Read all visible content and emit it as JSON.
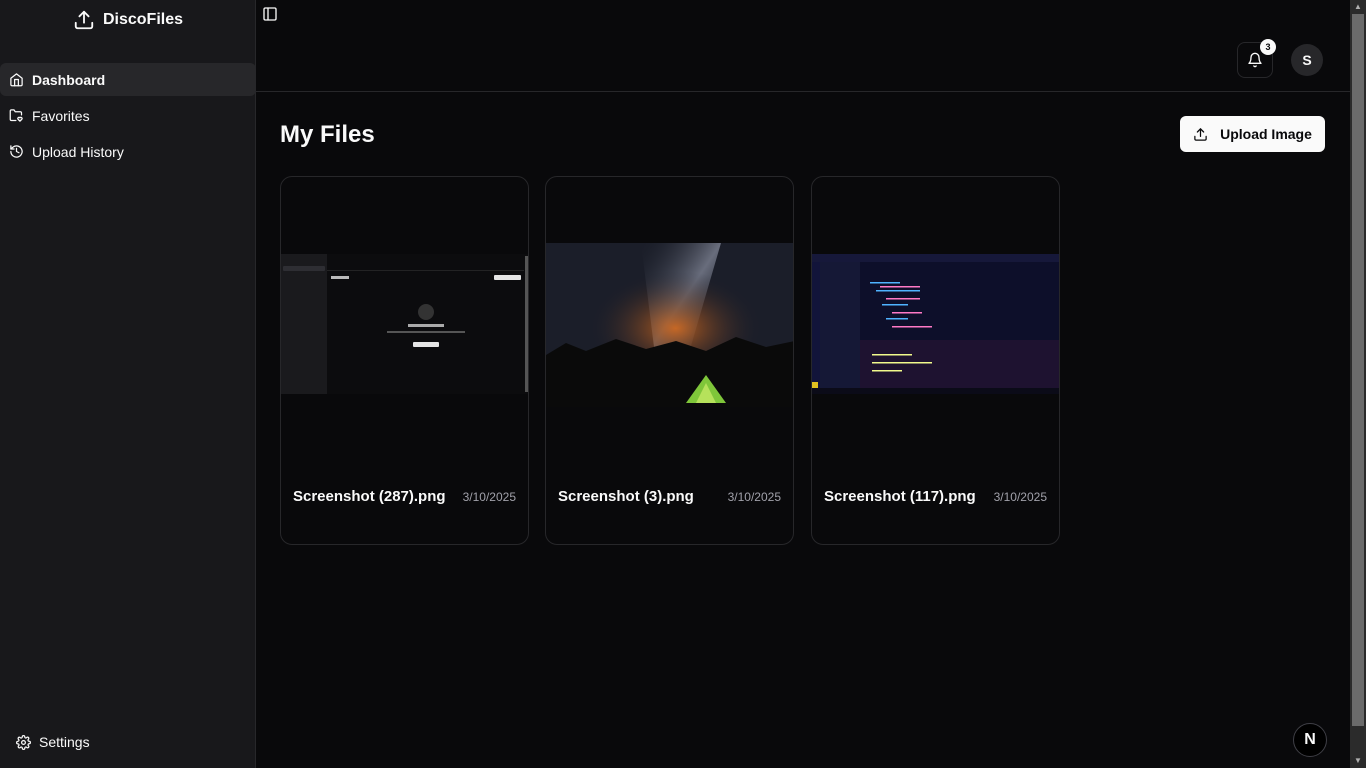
{
  "app": {
    "name": "DiscoFiles"
  },
  "sidebar": {
    "items": [
      {
        "label": "Dashboard",
        "icon": "home-icon",
        "active": true
      },
      {
        "label": "Favorites",
        "icon": "folder-heart-icon",
        "active": false
      },
      {
        "label": "Upload History",
        "icon": "history-icon",
        "active": false
      }
    ],
    "settings_label": "Settings"
  },
  "header": {
    "notification_count": "3",
    "avatar_initial": "S"
  },
  "main": {
    "title": "My Files",
    "upload_label": "Upload Image",
    "files": [
      {
        "name": "Screenshot (287).png",
        "date": "3/10/2025",
        "thumb": "app-screenshot"
      },
      {
        "name": "Screenshot (3).png",
        "date": "3/10/2025",
        "thumb": "night-sky"
      },
      {
        "name": "Screenshot (117).png",
        "date": "3/10/2025",
        "thumb": "code-editor"
      }
    ]
  },
  "dev_badge": {
    "letter": "N"
  },
  "colors": {
    "background": "#09090b",
    "sidebar": "#18181b",
    "border": "#27272a",
    "primary_button": "#fafafa"
  }
}
